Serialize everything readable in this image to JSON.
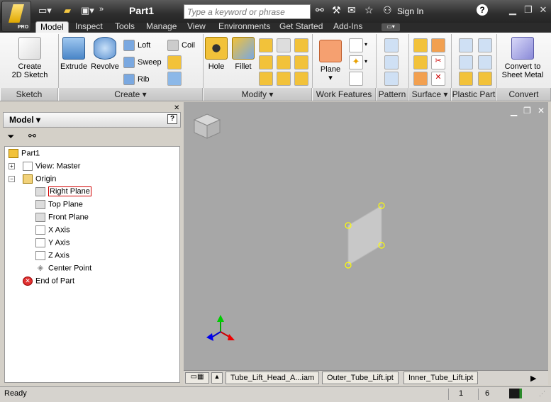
{
  "app": {
    "title": "Part1",
    "logo_badge": "PRO",
    "search_placeholder": "Type a keyword or phrase",
    "sign_in": "Sign In"
  },
  "tabs": [
    "Model",
    "Inspect",
    "Tools",
    "Manage",
    "View",
    "Environments",
    "Get Started",
    "Add-Ins"
  ],
  "active_tab": "Model",
  "ribbon": {
    "sketch": {
      "create_2d_sketch": "Create\n2D Sketch",
      "title": "Sketch"
    },
    "create": {
      "extrude": "Extrude",
      "revolve": "Revolve",
      "loft": "Loft",
      "sweep": "Sweep",
      "rib": "Rib",
      "coil": "Coil",
      "title": "Create"
    },
    "modify": {
      "hole": "Hole",
      "fillet": "Fillet",
      "title": "Modify"
    },
    "work_features": {
      "plane": "Plane",
      "title": "Work Features"
    },
    "pattern": {
      "title": "Pattern"
    },
    "surface": {
      "title": "Surface"
    },
    "plastic_part": {
      "title": "Plastic Part"
    },
    "convert": {
      "convert_to_sheet_metal": "Convert to\nSheet Metal",
      "title": "Convert"
    }
  },
  "browser": {
    "title": "Model",
    "tree": [
      {
        "label": "Part1",
        "icon": "part-icon"
      },
      {
        "label": "View: Master",
        "icon": "view-icon"
      },
      {
        "label": "Origin",
        "icon": "folder-icon"
      },
      {
        "label": "Right Plane",
        "icon": "plane-icon"
      },
      {
        "label": "Top Plane",
        "icon": "plane-icon"
      },
      {
        "label": "Front Plane",
        "icon": "plane-icon"
      },
      {
        "label": "X Axis",
        "icon": "axis-icon"
      },
      {
        "label": "Y Axis",
        "icon": "axis-icon"
      },
      {
        "label": "Z Axis",
        "icon": "axis-icon"
      },
      {
        "label": "Center Point",
        "icon": "point-icon"
      },
      {
        "label": "End of Part",
        "icon": "end-of-part-icon"
      }
    ]
  },
  "document_tabs": [
    "Tube_Lift_Head_A...iam",
    "Outer_Tube_Lift.ipt",
    "Inner_Tube_Lift.ipt"
  ],
  "status": {
    "text": "Ready",
    "value1": "1",
    "value2": "6"
  },
  "colors": {
    "accent": "#e8a000",
    "viewport_bg": "#a7a7a7",
    "selected_border": "#d00000"
  }
}
